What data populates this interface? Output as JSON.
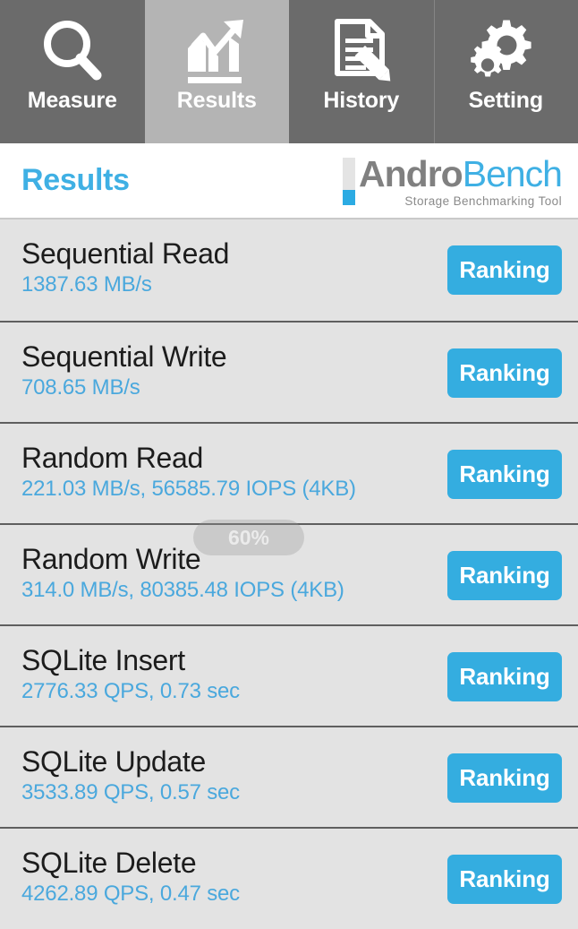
{
  "tabs": [
    {
      "label": "Measure",
      "icon": "magnifier-icon",
      "selected": false
    },
    {
      "label": "Results",
      "icon": "bar-chart-trend-icon",
      "selected": true
    },
    {
      "label": "History",
      "icon": "document-pencil-icon",
      "selected": false
    },
    {
      "label": "Setting",
      "icon": "gears-icon",
      "selected": false
    }
  ],
  "header": {
    "title": "Results",
    "logo_primary": "Andro",
    "logo_secondary": "Bench",
    "logo_subtitle": "Storage Benchmarking Tool"
  },
  "toast": {
    "text": "60%"
  },
  "results": [
    {
      "name": "Sequential Read",
      "value": "1387.63 MB/s",
      "action": "Ranking"
    },
    {
      "name": "Sequential Write",
      "value": "708.65 MB/s",
      "action": "Ranking"
    },
    {
      "name": "Random Read",
      "value": "221.03 MB/s, 56585.79 IOPS (4KB)",
      "action": "Ranking"
    },
    {
      "name": "Random Write",
      "value": "314.0 MB/s, 80385.48 IOPS (4KB)",
      "action": "Ranking"
    },
    {
      "name": "SQLite Insert",
      "value": "2776.33 QPS, 0.73 sec",
      "action": "Ranking"
    },
    {
      "name": "SQLite Update",
      "value": "3533.89 QPS, 0.57 sec",
      "action": "Ranking"
    },
    {
      "name": "SQLite Delete",
      "value": "4262.89 QPS, 0.47 sec",
      "action": "Ranking"
    }
  ],
  "colors": {
    "accent_blue": "#34ade0",
    "title_blue": "#3fb0e4",
    "value_blue": "#4aa8dd",
    "tab_bg": "#6b6b6b",
    "tab_selected_bg": "#b4b4b4",
    "list_bg": "#e3e3e3",
    "divider": "#5f5f5f"
  }
}
